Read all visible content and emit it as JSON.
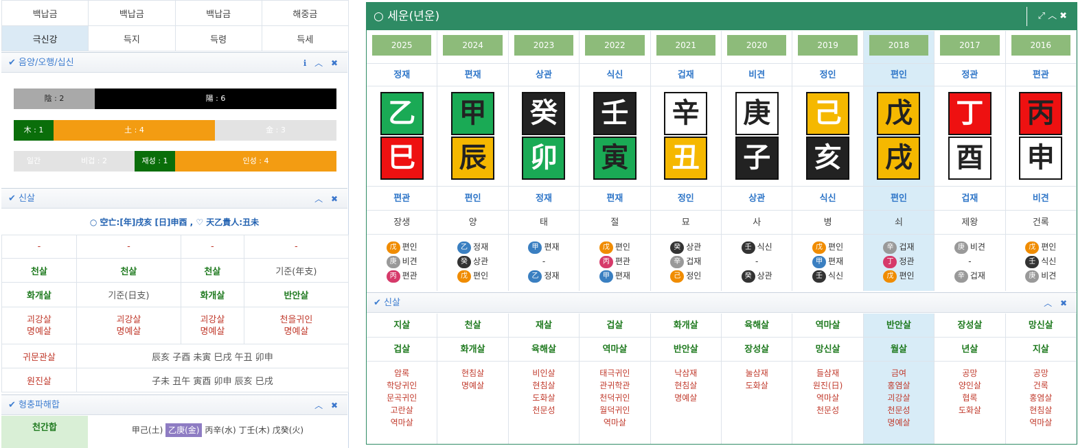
{
  "left": {
    "top_row": [
      "백납금",
      "백납금",
      "백납금",
      "해중금"
    ],
    "strength_row": [
      "극신강",
      "득지",
      "득령",
      "득세"
    ],
    "eumyang": {
      "title": "음양/오행/십신",
      "bars": {
        "um": "陰 : 2",
        "yang": "陽 : 6",
        "mok": "木 : 1",
        "to": "土 : 4",
        "geum": "金 : 3",
        "ilgan": "일간",
        "bigeop": "비겁 : 2",
        "jaeseong": "재성 : 1",
        "inseong": "인성 : 4"
      }
    },
    "sinsal": {
      "title": "신살",
      "gongmang": "空亡:[年]戌亥 [日]申酉 , ♡ 天乙貴人:丑未",
      "rows": [
        [
          "-",
          "-",
          "-",
          "-"
        ],
        [
          "천살",
          "천살",
          "천살",
          "기준(年支)"
        ],
        [
          "화개살",
          "기준(日支)",
          "화개살",
          "반안살"
        ],
        [
          "괴강살\n명예살",
          "괴강살\n명예살",
          "괴강살\n명예살",
          "천을귀인\n명예살"
        ]
      ],
      "gwimun_label": "귀문관살",
      "gwimun_value": "辰亥 子酉 未寅 巳戌 午丑 卯申",
      "wonjin_label": "원진살",
      "wonjin_value": "子未 丑午 寅酉 卯申 辰亥 巳戌"
    },
    "hyeong": {
      "title": "형충파해합",
      "cheongan_label": "천간합",
      "items": [
        "甲己(土)",
        "乙庚(金)",
        "丙辛(水)",
        "丁壬(木)",
        "戊癸(火)"
      ]
    }
  },
  "right": {
    "title": "세운(년운)",
    "years": [
      "2025",
      "2024",
      "2023",
      "2022",
      "2021",
      "2020",
      "2019",
      "2018",
      "2017",
      "2016"
    ],
    "top_sipsin": [
      "정재",
      "편재",
      "상관",
      "식신",
      "겁재",
      "비견",
      "정인",
      "편인",
      "정관",
      "편관"
    ],
    "stems": [
      "乙",
      "甲",
      "癸",
      "壬",
      "辛",
      "庚",
      "己",
      "戊",
      "丁",
      "丙"
    ],
    "stem_colors": [
      "#1aaa55",
      "#1aaa55",
      "#222222",
      "#222222",
      "#ffffff",
      "#ffffff",
      "#f5b800",
      "#f5b800",
      "#ee1111",
      "#ee1111"
    ],
    "stem_text": [
      "#ffffff",
      "#222222",
      "#ffffff",
      "#ffffff",
      "#222222",
      "#222222",
      "#ffffff",
      "#222222",
      "#ffffff",
      "#222222"
    ],
    "branches": [
      "巳",
      "辰",
      "卯",
      "寅",
      "丑",
      "子",
      "亥",
      "戌",
      "酉",
      "申"
    ],
    "branch_colors": [
      "#ee1111",
      "#f5b800",
      "#1aaa55",
      "#1aaa55",
      "#f5b800",
      "#222222",
      "#222222",
      "#f5b800",
      "#ffffff",
      "#ffffff"
    ],
    "branch_text": [
      "#ffffff",
      "#222222",
      "#ffffff",
      "#222222",
      "#ffffff",
      "#ffffff",
      "#ffffff",
      "#222222",
      "#222222",
      "#222222"
    ],
    "bottom_sipsin": [
      "편관",
      "편인",
      "정재",
      "편재",
      "정인",
      "상관",
      "식신",
      "편인",
      "겁재",
      "비견"
    ],
    "unseong": [
      "장생",
      "양",
      "태",
      "절",
      "묘",
      "사",
      "병",
      "쇠",
      "제왕",
      "건록"
    ],
    "jijanggan": [
      [
        [
          "戊",
          "#f08c00",
          "편인"
        ],
        [
          "庚",
          "#999999",
          "비견"
        ],
        [
          "丙",
          "#d63a6a",
          "편관"
        ]
      ],
      [
        [
          "乙",
          "#3a7fc1",
          "정재"
        ],
        [
          "癸",
          "#333333",
          "상관"
        ],
        [
          "戊",
          "#f08c00",
          "편인"
        ]
      ],
      [
        [
          "甲",
          "#3a7fc1",
          "편재"
        ],
        [
          "-",
          "",
          ""
        ],
        [
          "乙",
          "#3a7fc1",
          "정재"
        ]
      ],
      [
        [
          "戊",
          "#f08c00",
          "편인"
        ],
        [
          "丙",
          "#d63a6a",
          "편관"
        ],
        [
          "甲",
          "#3a7fc1",
          "편재"
        ]
      ],
      [
        [
          "癸",
          "#333333",
          "상관"
        ],
        [
          "辛",
          "#999999",
          "겁재"
        ],
        [
          "己",
          "#f08c00",
          "정인"
        ]
      ],
      [
        [
          "壬",
          "#333333",
          "식신"
        ],
        [
          "-",
          "",
          ""
        ],
        [
          "癸",
          "#333333",
          "상관"
        ]
      ],
      [
        [
          "戊",
          "#f08c00",
          "편인"
        ],
        [
          "甲",
          "#3a7fc1",
          "편재"
        ],
        [
          "壬",
          "#333333",
          "식신"
        ]
      ],
      [
        [
          "辛",
          "#999999",
          "겁재"
        ],
        [
          "丁",
          "#d63a6a",
          "정관"
        ],
        [
          "戊",
          "#f08c00",
          "편인"
        ]
      ],
      [
        [
          "庚",
          "#999999",
          "비견"
        ],
        [
          "-",
          "",
          ""
        ],
        [
          "辛",
          "#999999",
          "겁재"
        ]
      ],
      [
        [
          "戊",
          "#f08c00",
          "편인"
        ],
        [
          "壬",
          "#333333",
          "식신"
        ],
        [
          "庚",
          "#999999",
          "비견"
        ]
      ]
    ],
    "sinsal_title": "신살",
    "sinsal_row1": [
      "지살",
      "천살",
      "재살",
      "겁살",
      "화개살",
      "육해살",
      "역마살",
      "반안살",
      "장성살",
      "망신살"
    ],
    "sinsal_row2": [
      "겁살",
      "화개살",
      "육해살",
      "역마살",
      "반안살",
      "장성살",
      "망신살",
      "월살",
      "년살",
      "지살"
    ],
    "sinsal_list": [
      [
        "암록",
        "학당귀인",
        "문곡귀인",
        "고란살",
        "역마살"
      ],
      [
        "현침살",
        "명예살"
      ],
      [
        "비인살",
        "현침살",
        "도화살",
        "천문성"
      ],
      [
        "태극귀인",
        "관귀학관",
        "천덕귀인",
        "월덕귀인",
        "역마살"
      ],
      [
        "낙삼재",
        "현침살",
        "명예살"
      ],
      [
        "눌삼재",
        "도화살"
      ],
      [
        "들삼재",
        "원진(日)",
        "역마살",
        "천문성"
      ],
      [
        "금여",
        "홍염살",
        "괴강살",
        "천문성",
        "명예살"
      ],
      [
        "공망",
        "양인살",
        "협록",
        "도화살"
      ],
      [
        "공망",
        "건록",
        "홍염살",
        "현침살",
        "역마살"
      ]
    ]
  }
}
